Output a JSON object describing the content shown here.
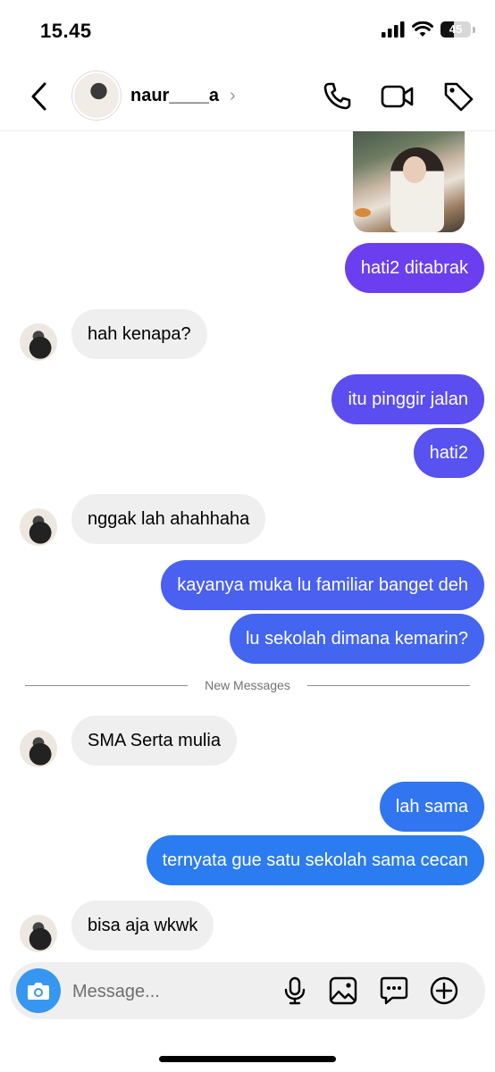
{
  "status_bar": {
    "time": "15.45",
    "battery": "45",
    "battery_level": 0.45
  },
  "header": {
    "contact_name": "naur____a",
    "chevron": "›"
  },
  "composer": {
    "placeholder": "Message..."
  },
  "divider": {
    "label": "New Messages"
  },
  "colors": {
    "accent_blue": "#3797f0",
    "incoming_bubble": "#efefef",
    "out_gradient_top": "#6b3ff0",
    "out_gradient_bottom": "#2a7df0"
  },
  "messages": [
    {
      "from": "me",
      "text": "hati2 ditabrak"
    },
    {
      "from": "them",
      "text": "hah kenapa?"
    },
    {
      "from": "me",
      "text": "itu pinggir jalan"
    },
    {
      "from": "me",
      "text": "hati2"
    },
    {
      "from": "them",
      "text": "nggak lah ahahhaha"
    },
    {
      "from": "me",
      "text": "kayanya muka lu familiar banget deh"
    },
    {
      "from": "me",
      "text": "lu sekolah dimana kemarin?"
    },
    {
      "from": "them",
      "text": "SMA Serta mulia"
    },
    {
      "from": "me",
      "text": "lah sama"
    },
    {
      "from": "me",
      "text": "ternyata gue satu sekolah sama cecan"
    },
    {
      "from": "them",
      "text": "bisa aja wkwk"
    }
  ]
}
